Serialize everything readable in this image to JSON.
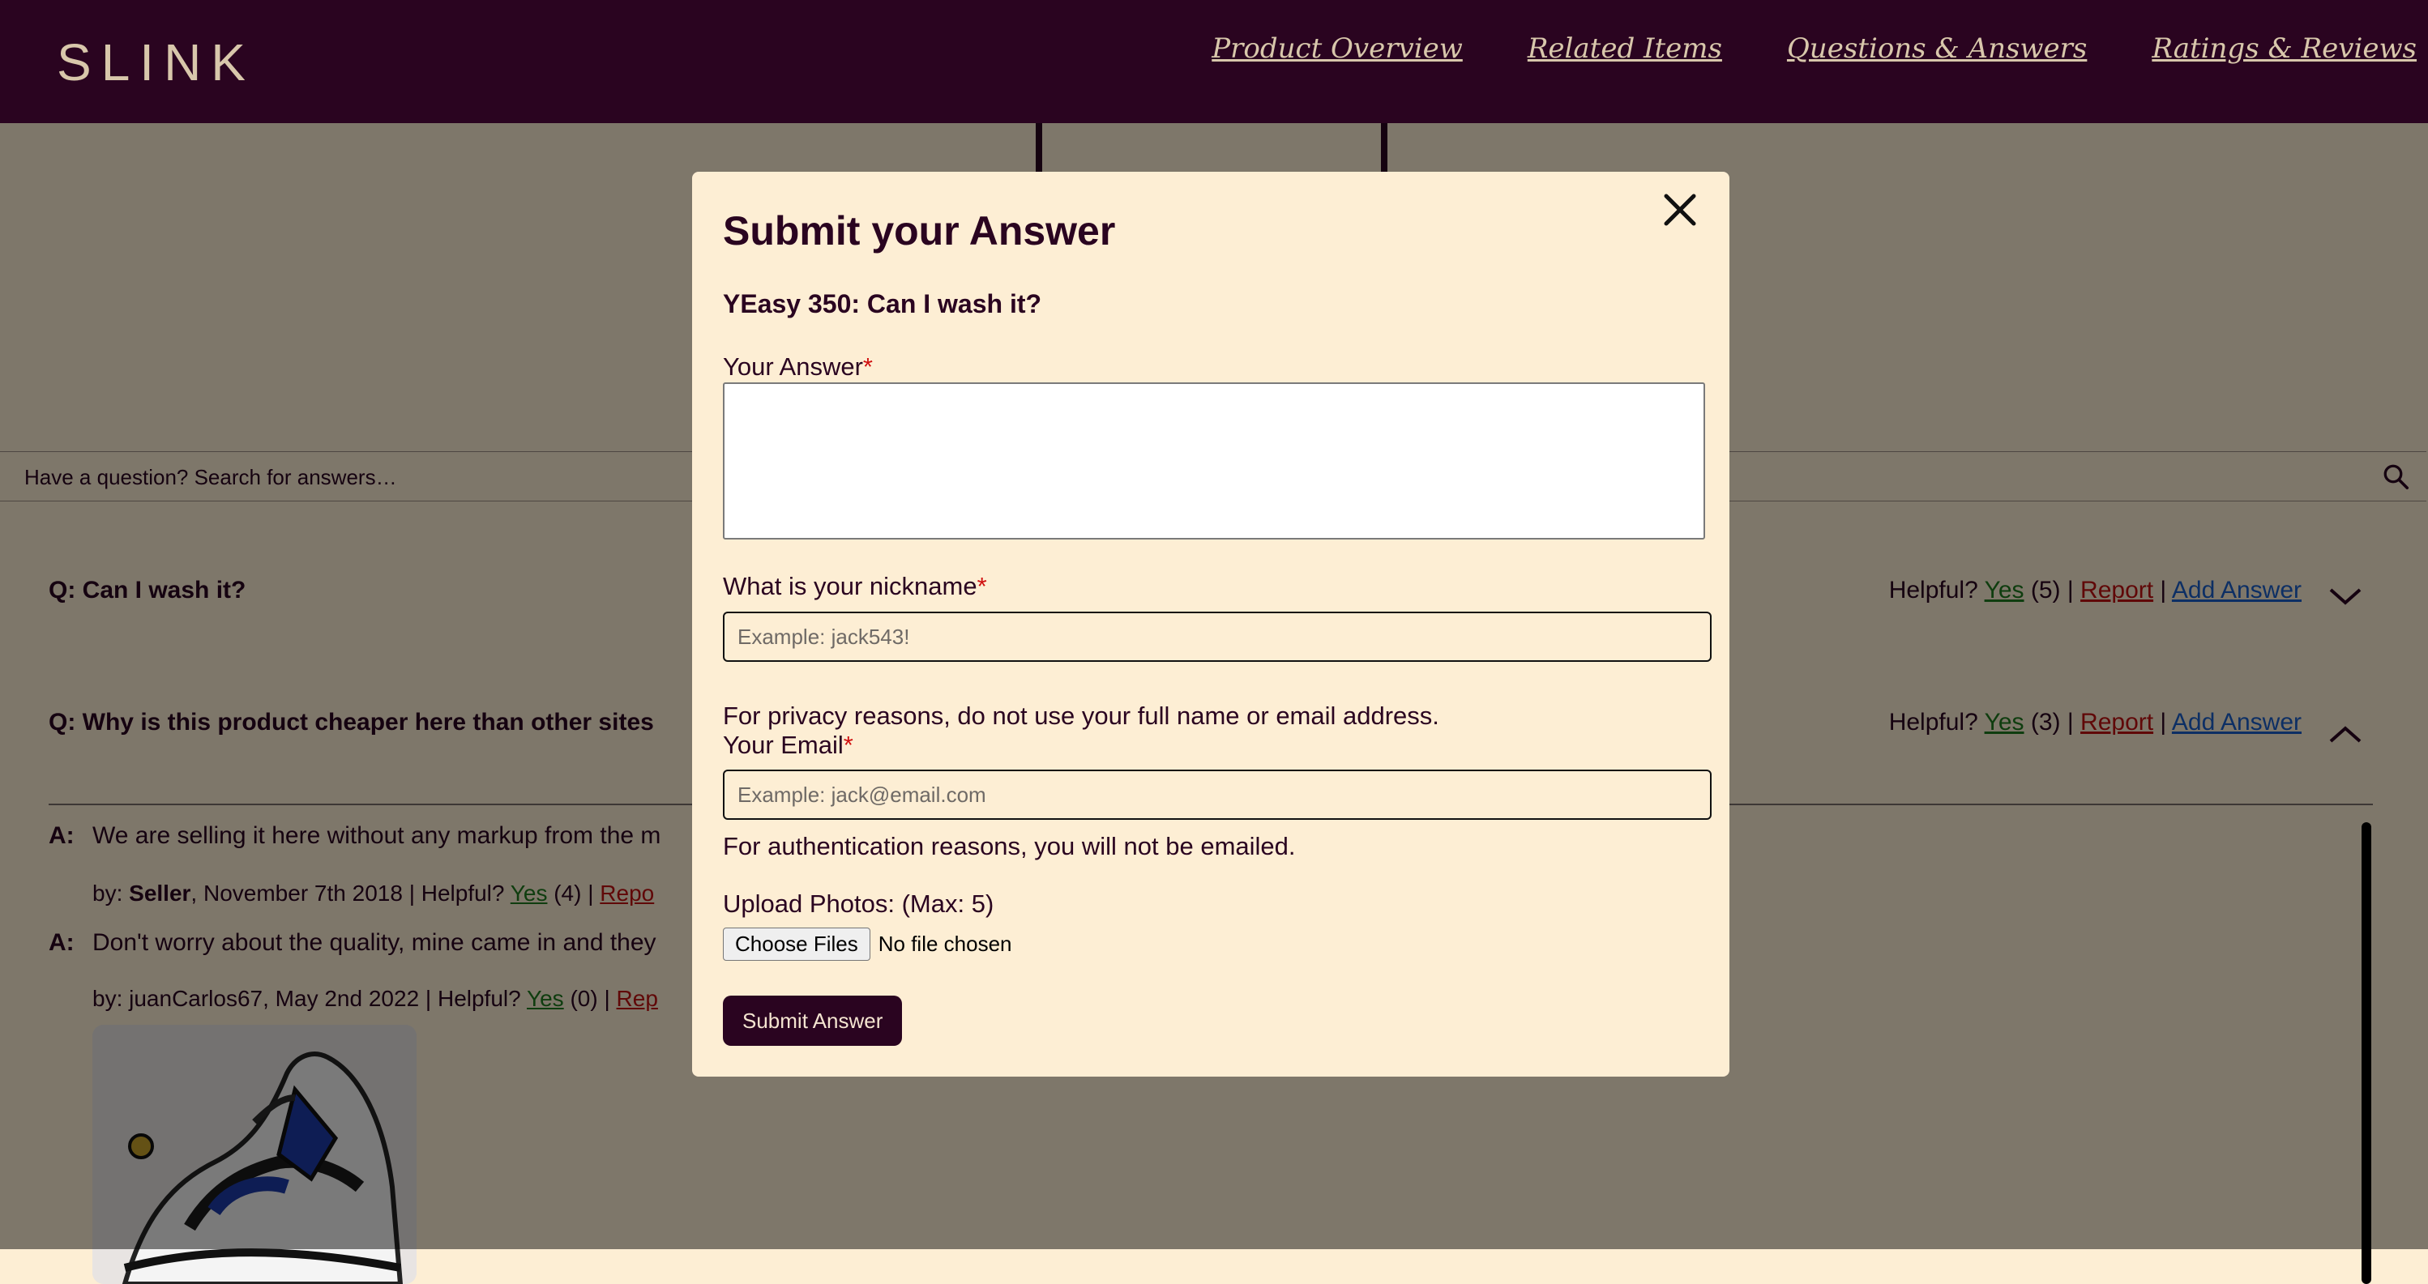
{
  "header": {
    "logo": "SLINK",
    "nav": [
      "Product Overview",
      "Related Items",
      "Questions & Answers",
      "Ratings & Reviews"
    ]
  },
  "search": {
    "placeholder": "Have a question? Search for answers…"
  },
  "questions": [
    {
      "text": "Q: Can I wash it?",
      "helpful_label": "Helpful?",
      "yes": "Yes",
      "count": "(5)",
      "sep": "|",
      "report": "Report",
      "add_answer": "Add Answer"
    },
    {
      "text": "Q: Why is this product cheaper here than other sites",
      "helpful_label": "Helpful?",
      "yes": "Yes",
      "count": "(3)",
      "sep": "|",
      "report": "Report",
      "add_answer": "Add Answer",
      "answers": [
        {
          "label": "A:",
          "text": "We are selling it here without any markup from the m",
          "by": "by:",
          "author": "Seller",
          "date": ", November 7th 2018 | Helpful?",
          "yes": "Yes",
          "count": "(4) |",
          "report": "Repo"
        },
        {
          "label": "A:",
          "text": "Don't worry about the quality, mine came in and they",
          "by": "by: juanCarlos67, May 2nd 2022 | Helpful?",
          "yes": "Yes",
          "count": "(0) |",
          "report": "Rep"
        }
      ]
    }
  ],
  "modal": {
    "title": "Submit your Answer",
    "subtitle": "YEasy 350: Can I wash it?",
    "answer_label": "Your Answer",
    "nickname_label": "What is your nickname",
    "nickname_placeholder": "Example: jack543!",
    "privacy_note": "For privacy reasons, do not use your full name or email address.",
    "email_label": "Your Email",
    "email_placeholder": "Example: jack@email.com",
    "auth_note": "For authentication reasons, you will not be emailed.",
    "upload_label": "Upload Photos: (Max: 5)",
    "choose_files": "Choose Files",
    "no_file": "No file chosen",
    "submit": "Submit Answer",
    "required_mark": "*"
  },
  "colors": {
    "brand": "#2a0420",
    "background": "#fdeed4",
    "link_yes": "#1e7a1e",
    "link_report": "#c01010",
    "link_add": "#1a5ec8"
  }
}
